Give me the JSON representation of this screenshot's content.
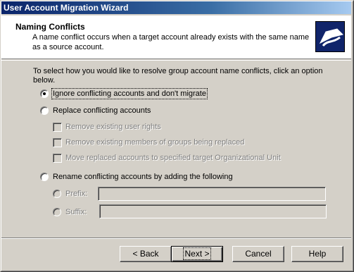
{
  "window": {
    "title": "User Account Migration Wizard"
  },
  "header": {
    "title": "Naming Conflicts",
    "description": "A name conflict occurs when a target account already exists with the same name as a source account."
  },
  "intro": "To select how you would like to resolve group account name conflicts, click an option below.",
  "options": {
    "ignore": {
      "label": "Ignore conflicting accounts and don't migrate",
      "selected": true
    },
    "replace": {
      "label": "Replace conflicting accounts",
      "selected": false
    },
    "rename": {
      "label": "Rename conflicting accounts by adding the following",
      "selected": false
    }
  },
  "replace_suboptions": {
    "remove_rights": "Remove existing user rights",
    "remove_members": "Remove existing members of groups being replaced",
    "move_ou": "Move replaced accounts to specified target Organizational Unit"
  },
  "rename_suboptions": {
    "prefix_label": "Prefix:",
    "prefix_value": "",
    "suffix_label": "Suffix:",
    "suffix_value": ""
  },
  "buttons": {
    "back": "< Back",
    "next": "Next >",
    "cancel": "Cancel",
    "help": "Help"
  },
  "colors": {
    "titlebar_start": "#0a246a",
    "titlebar_end": "#a6caf0",
    "face": "#d4d0c8"
  }
}
